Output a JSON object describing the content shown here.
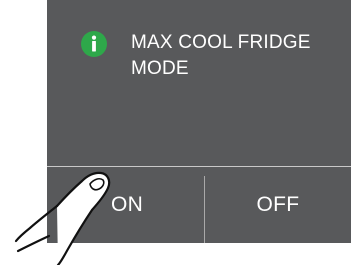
{
  "dialog": {
    "icon": "info-icon",
    "message_line1": "MAX COOL FRIDGE",
    "message_line2": "MODE",
    "on_label": "ON",
    "off_label": "OFF"
  },
  "illustration": {
    "pointer": "hand-pointer-icon"
  },
  "colors": {
    "panel": "#58595b",
    "icon": "#2ea84a",
    "text": "#ffffff"
  }
}
